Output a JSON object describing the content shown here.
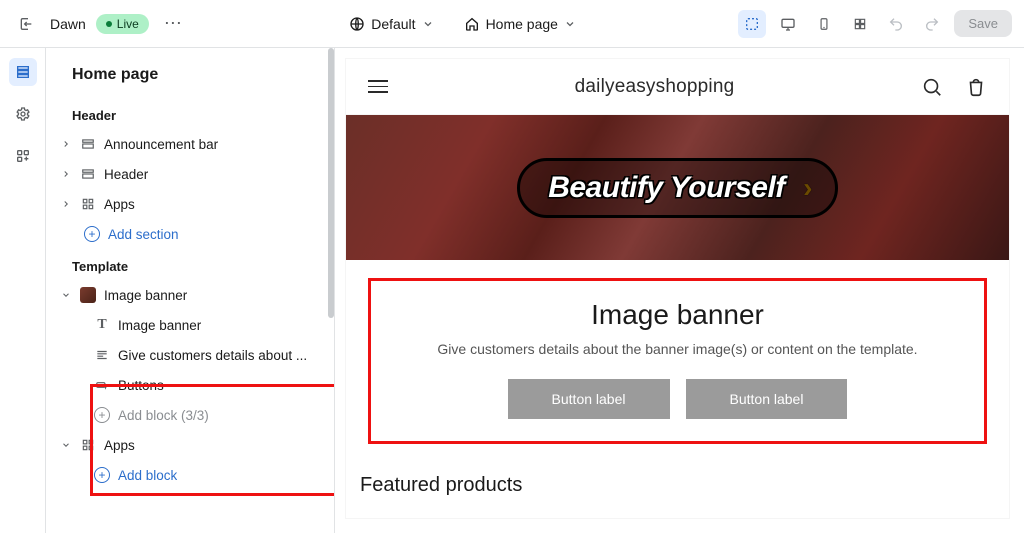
{
  "topbar": {
    "theme_name": "Dawn",
    "live_label": "Live",
    "layout_label": "Default",
    "page_label": "Home page",
    "save_label": "Save"
  },
  "sidebar": {
    "page_title": "Home page",
    "header": {
      "label": "Header",
      "items": [
        {
          "label": "Announcement bar"
        },
        {
          "label": "Header"
        },
        {
          "label": "Apps"
        }
      ],
      "add_section": "Add section"
    },
    "template": {
      "label": "Template",
      "image_banner": {
        "label": "Image banner",
        "children": [
          {
            "label": "Image banner"
          },
          {
            "label": "Give customers details about ..."
          },
          {
            "label": "Buttons"
          }
        ],
        "add_block_disabled": "Add block (3/3)"
      },
      "apps": {
        "label": "Apps",
        "add_block": "Add block"
      }
    }
  },
  "preview": {
    "store_name": "dailyeasyshopping",
    "hero_text": "Beautify Yourself",
    "image_banner": {
      "title": "Image banner",
      "subtitle": "Give customers details about the banner image(s) or content on the template.",
      "button1": "Button label",
      "button2": "Button label"
    },
    "featured_label": "Featured products"
  }
}
